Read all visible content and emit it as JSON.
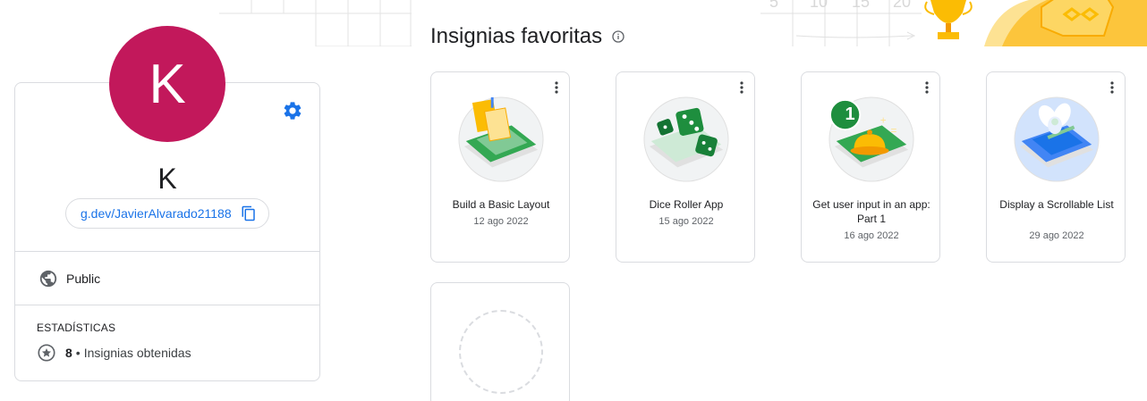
{
  "profile": {
    "avatar_letter": "K",
    "avatar_color": "#c2185b",
    "name": "K",
    "profile_url": "g.dev/JavierAlvarado21188",
    "visibility": "Public",
    "stats_title": "ESTADÍSTICAS",
    "badge_count": "8",
    "stats_separator": "•",
    "badge_count_label": "Insignias obtenidas"
  },
  "icons": {
    "settings": "gear-icon",
    "copy": "copy-icon",
    "visibility": "globe-icon",
    "badges": "star-badge-icon",
    "info": "info-icon",
    "menu": "more-vert-icon"
  },
  "section": {
    "title": "Insignias favoritas"
  },
  "badges": [
    {
      "title": "Build a Basic Layout",
      "date": "12 ago 2022",
      "icon": "layout-badge"
    },
    {
      "title": "Dice Roller App",
      "date": "15 ago 2022",
      "icon": "dice-badge"
    },
    {
      "title": "Get user input in an app: Part 1",
      "date": "16 ago 2022",
      "icon": "bell-badge",
      "badge_number": "1"
    },
    {
      "title": "Display a Scrollable List",
      "date": "29 ago 2022",
      "icon": "flower-badge"
    }
  ],
  "colors": {
    "accent": "#1a73e8",
    "border": "#dadce0",
    "badge_green": "#34a853",
    "deco_yellow": "#fbbc04"
  }
}
